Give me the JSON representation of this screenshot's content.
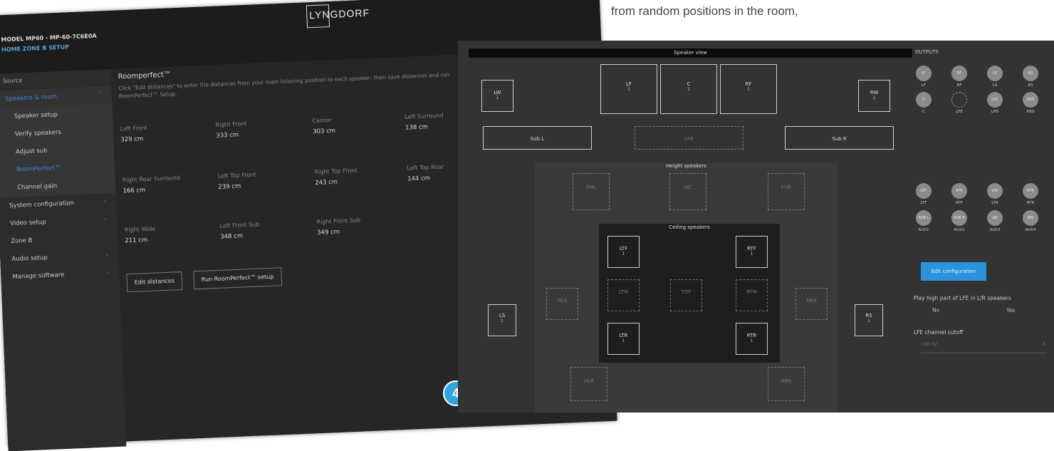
{
  "caption": "from random positions in the room,",
  "left_screen": {
    "model": "MODEL MP60 - MP-60-7C6E0A",
    "breadcrumb": "HOME  ZONE B  SETUP",
    "logo": "LYNGDORF",
    "source_label": "Source",
    "menu": [
      {
        "label": "Speakers & room",
        "sub": false,
        "sel": true,
        "chev": "˅"
      },
      {
        "label": "Speaker setup",
        "sub": true
      },
      {
        "label": "Verify speakers",
        "sub": true
      },
      {
        "label": "Adjust sub",
        "sub": true
      },
      {
        "label": "RoomPerfect™",
        "sub": true,
        "active": true
      },
      {
        "label": "Channel gain",
        "sub": true
      },
      {
        "label": "System configuration",
        "chev": "›"
      },
      {
        "label": "Video setup",
        "chev": "›"
      },
      {
        "label": "Zone B"
      },
      {
        "label": "Audio setup",
        "chev": "›"
      },
      {
        "label": "Manage software",
        "chev": "›"
      }
    ],
    "roomperfect_title": "Roomperfect™",
    "roomperfect_desc": "Click \"Edit distances\" to enter the distances from your main listening position to each speaker, then save distances and run RoomPerfect™ Setup.",
    "distances": [
      {
        "label": "Left Front",
        "value": "329 cm"
      },
      {
        "label": "Right Front",
        "value": "333 cm"
      },
      {
        "label": "Center",
        "value": "303 cm"
      },
      {
        "label": "Left Surround",
        "value": "138 cm"
      },
      {
        "label": "Right Rear Surround",
        "value": "166 cm"
      },
      {
        "label": "Left Top Front",
        "value": "239 cm"
      },
      {
        "label": "Right Top Front",
        "value": "243 cm"
      },
      {
        "label": "Left Top Rear",
        "value": "144 cm"
      },
      {
        "label": "Right Wide",
        "value": "211 cm"
      },
      {
        "label": "Left Front Sub",
        "value": "348 cm"
      },
      {
        "label": "Right Front Sub",
        "value": "349 cm"
      }
    ],
    "edit_distances": "Edit distances",
    "run_setup": "Run RoomPerfect™ setup",
    "badge": "4"
  },
  "right_screen": {
    "speaker_view_title": "Speaker view",
    "speakers": {
      "lw": {
        "name": "LW",
        "count": "1"
      },
      "lf": {
        "name": "LF",
        "count": "1"
      },
      "c": {
        "name": "C",
        "count": "1"
      },
      "rf": {
        "name": "RF",
        "count": "1"
      },
      "rw": {
        "name": "RW",
        "count": "1"
      },
      "sub_l": {
        "name": "Sub L"
      },
      "lfe": {
        "name": "LFE"
      },
      "sub_r": {
        "name": "Sub R"
      },
      "fh_l": {
        "name": "FHL"
      },
      "ch": {
        "name": "HC"
      },
      "fh_r": {
        "name": "FHR"
      },
      "ltf": {
        "name": "LTF",
        "count": "1"
      },
      "rtf": {
        "name": "RTF",
        "count": "1"
      },
      "ltm": {
        "name": "LTM"
      },
      "top": {
        "name": "TOP"
      },
      "rtm": {
        "name": "RTM"
      },
      "ltr": {
        "name": "LTR",
        "count": "1"
      },
      "rtr": {
        "name": "RTR",
        "count": "1"
      },
      "hl": {
        "name": "HLS"
      },
      "hr": {
        "name": "HRS"
      },
      "ls": {
        "name": "LS",
        "count": "1"
      },
      "rs": {
        "name": "RS",
        "count": "1"
      },
      "hlr": {
        "name": "HLR"
      },
      "hrr": {
        "name": "HRR"
      }
    },
    "height_title": "Height speakers",
    "ceiling_title": "Ceiling speakers",
    "outputs_title": "OUTPUTS",
    "outputs": [
      {
        "c": "LF",
        "l": "LF"
      },
      {
        "c": "RF",
        "l": "RF"
      },
      {
        "c": "LS",
        "l": "LS"
      },
      {
        "c": "RS",
        "l": "RS"
      },
      {
        "c": "C",
        "l": "C"
      },
      {
        "c": "",
        "l": "LFE",
        "ring": true
      },
      {
        "c": "LRS",
        "l": "LRS"
      },
      {
        "c": "RRS",
        "l": "RRS"
      },
      {
        "c": "LTF",
        "l": "LTF"
      },
      {
        "c": "RTF",
        "l": "RTF"
      },
      {
        "c": "LTR",
        "l": "LTR"
      },
      {
        "c": "RTR",
        "l": "RTR"
      },
      {
        "c": "SUB L",
        "l": "AUX1"
      },
      {
        "c": "SUB R",
        "l": "AUX2"
      },
      {
        "c": "LW",
        "l": "AUX3"
      },
      {
        "c": "RW",
        "l": "AUX4"
      }
    ],
    "edit_configuration": "Edit configuration",
    "play_high": "Play high part of LFE in L/R speakers",
    "opt_no": "No",
    "opt_yes": "Yes",
    "lfe_cutoff": "LFE channel cutoff",
    "lfe_value": "100 Hz"
  }
}
